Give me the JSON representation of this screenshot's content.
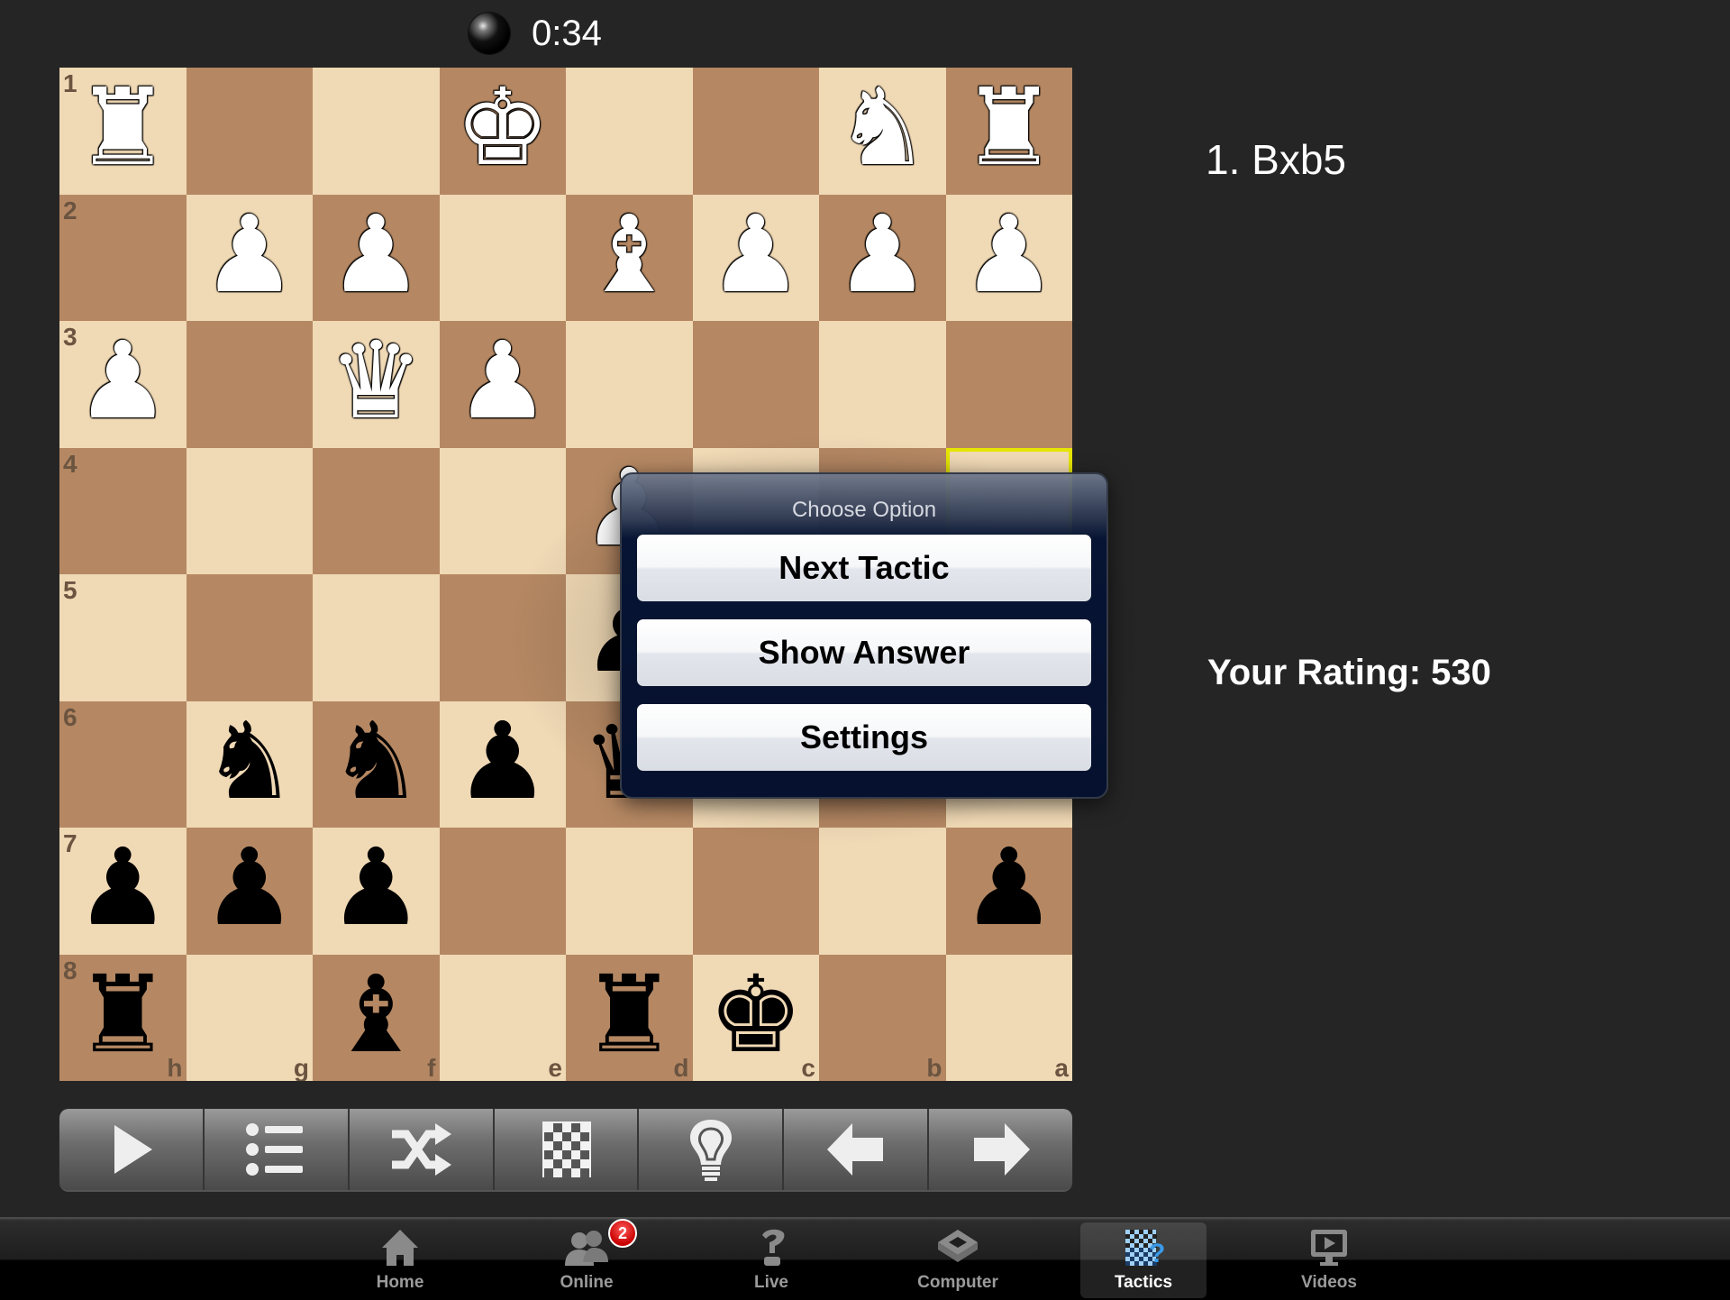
{
  "clock": {
    "side": "black",
    "time": "0:34"
  },
  "board": {
    "orientation": "black",
    "rank_labels": [
      "1",
      "2",
      "3",
      "4",
      "5",
      "6",
      "7",
      "8"
    ],
    "file_labels": [
      "h",
      "g",
      "f",
      "e",
      "d",
      "c",
      "b",
      "a"
    ],
    "highlight": "a4",
    "rows": [
      [
        "wR",
        "",
        "",
        "wK",
        "",
        "",
        "wN",
        "wR"
      ],
      [
        "",
        "wP",
        "wP",
        "",
        "wB",
        "wP",
        "wP",
        "wP"
      ],
      [
        "wP",
        "",
        "wQ",
        "wP",
        "",
        "",
        "",
        ""
      ],
      [
        "",
        "",
        "",
        "",
        "wP",
        "",
        "",
        ""
      ],
      [
        "",
        "",
        "",
        "",
        "bP",
        "",
        "",
        ""
      ],
      [
        "",
        "bN",
        "bN",
        "bP",
        "bQ",
        "bP",
        "",
        ""
      ],
      [
        "bP",
        "bP",
        "bP",
        "",
        "",
        "",
        "",
        "bP"
      ],
      [
        "bR",
        "",
        "bB",
        "",
        "bR",
        "bK",
        "",
        ""
      ]
    ]
  },
  "moves": {
    "text": "1. Bxb5"
  },
  "rating": {
    "text": "Your Rating: 530"
  },
  "popup": {
    "title": "Choose Option",
    "options": [
      {
        "label": "Next Tactic"
      },
      {
        "label": "Show Answer"
      },
      {
        "label": "Settings"
      }
    ]
  },
  "toolbar": {
    "buttons": [
      {
        "icon": "play-icon"
      },
      {
        "icon": "move-list-icon"
      },
      {
        "icon": "shuffle-icon"
      },
      {
        "icon": "flip-board-icon"
      },
      {
        "icon": "hint-lightbulb-icon"
      },
      {
        "icon": "back-arrow-icon"
      },
      {
        "icon": "forward-arrow-icon"
      }
    ]
  },
  "tabbar": {
    "active": "Tactics",
    "tabs": [
      {
        "label": "Home",
        "icon": "home-icon"
      },
      {
        "label": "Online",
        "icon": "users-icon",
        "badge": "2"
      },
      {
        "label": "Live",
        "icon": "live-pawn-icon"
      },
      {
        "label": "Computer",
        "icon": "computer-chip-icon"
      },
      {
        "label": "Tactics",
        "icon": "tactics-board-icon"
      },
      {
        "label": "Videos",
        "icon": "video-monitor-icon"
      }
    ]
  },
  "colors": {
    "light_square": "#f0d9b5",
    "dark_square": "#b58863",
    "highlight": "#e5e500",
    "background": "#252525",
    "tactics_accent": "#3a9ae8",
    "badge": "#c80000"
  }
}
